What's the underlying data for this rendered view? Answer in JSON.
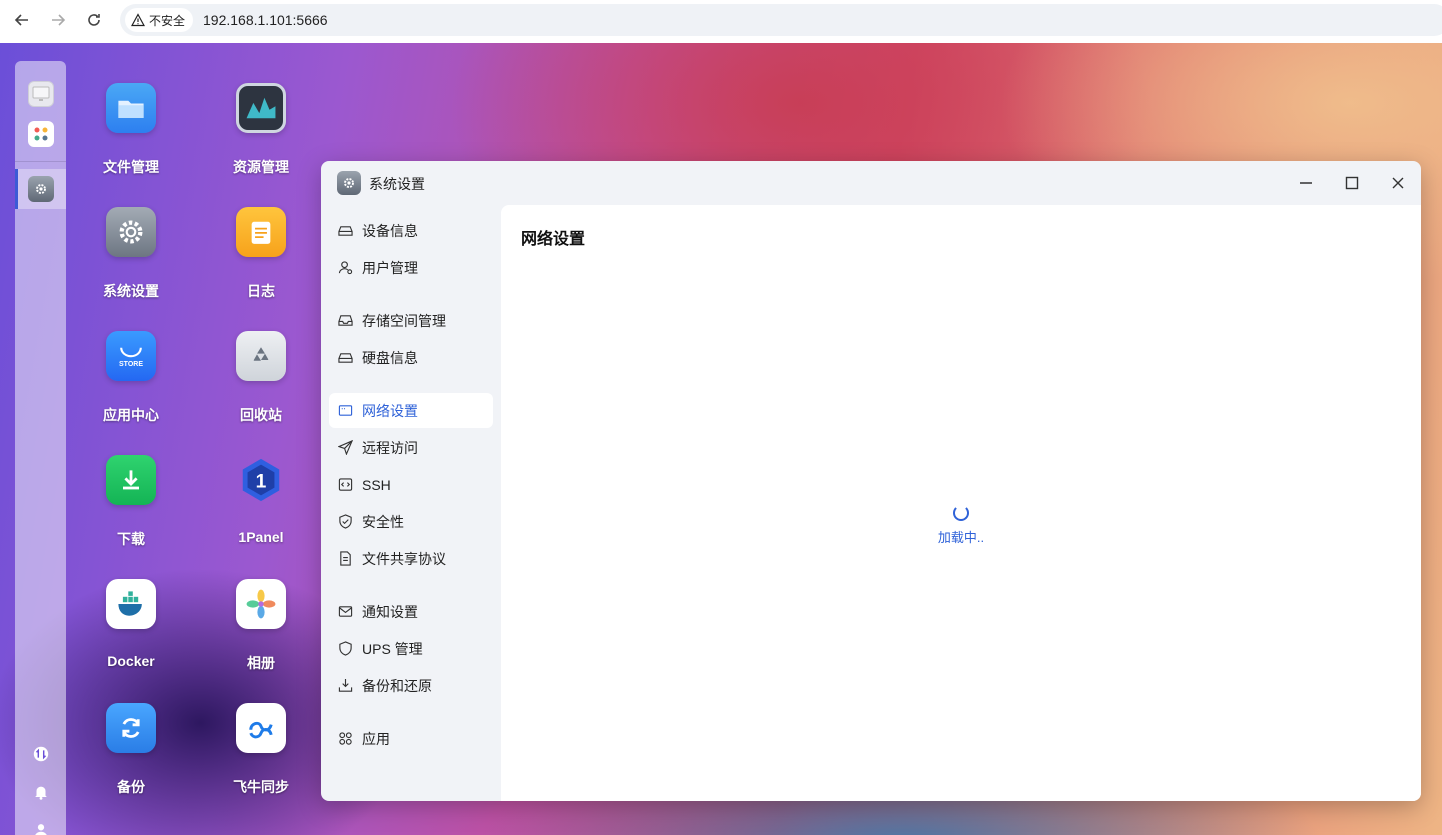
{
  "browser": {
    "security_label": "不安全",
    "url": "192.168.1.101:5666"
  },
  "desktop_apps": [
    {
      "label": "文件管理",
      "icon": "folder-icon"
    },
    {
      "label": "资源管理",
      "icon": "activity-monitor-icon"
    },
    {
      "label": "系统设置",
      "icon": "gear-icon"
    },
    {
      "label": "日志",
      "icon": "notes-icon"
    },
    {
      "label": "应用中心",
      "icon": "store-icon"
    },
    {
      "label": "回收站",
      "icon": "recycle-bin-icon"
    },
    {
      "label": "下载",
      "icon": "download-icon"
    },
    {
      "label": "1Panel",
      "icon": "1panel-icon"
    },
    {
      "label": "Docker",
      "icon": "docker-icon"
    },
    {
      "label": "相册",
      "icon": "photos-icon"
    },
    {
      "label": "备份",
      "icon": "backup-icon"
    },
    {
      "label": "飞牛同步",
      "icon": "sync-icon"
    }
  ],
  "store_icon_text": "STORE",
  "panel_icon_text": "1",
  "window": {
    "title": "系统设置",
    "content_title": "网络设置",
    "loading_text": "加载中.."
  },
  "sidebar": {
    "items": [
      {
        "label": "设备信息",
        "icon": "drive-icon"
      },
      {
        "label": "用户管理",
        "icon": "users-icon"
      },
      {
        "label": "存储空间管理",
        "icon": "inbox-icon"
      },
      {
        "label": "硬盘信息",
        "icon": "drive-icon"
      },
      {
        "label": "网络设置",
        "icon": "network-icon",
        "active": true
      },
      {
        "label": "远程访问",
        "icon": "send-icon"
      },
      {
        "label": "SSH",
        "icon": "code-icon"
      },
      {
        "label": "安全性",
        "icon": "shield-check-icon"
      },
      {
        "label": "文件共享协议",
        "icon": "file-icon"
      },
      {
        "label": "通知设置",
        "icon": "mail-icon"
      },
      {
        "label": "UPS 管理",
        "icon": "shield-icon"
      },
      {
        "label": "备份和还原",
        "icon": "backup-restore-icon"
      },
      {
        "label": "应用",
        "icon": "apps-icon"
      }
    ]
  },
  "colors": {
    "accent": "#2f62d8"
  }
}
